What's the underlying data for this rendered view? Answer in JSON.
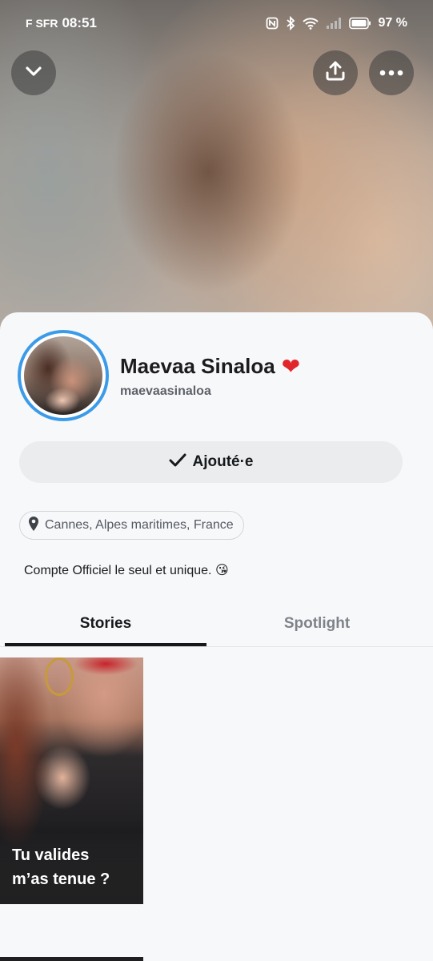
{
  "status_bar": {
    "carrier": "F SFR",
    "time": "08:51",
    "battery": "97 %"
  },
  "profile": {
    "display_name": "Maevaa Sinaloa",
    "name_emoji": "❤",
    "username": "maevaasinaloa",
    "add_button_label": "Ajouté·e",
    "location": "Cannes, Alpes maritimes, France",
    "bio": "Compte Officiel le seul et unique. 😘"
  },
  "tabs": [
    {
      "label": "Stories",
      "active": true
    },
    {
      "label": "Spotlight",
      "active": false
    }
  ],
  "stories": [
    {
      "caption_line1": "Tu valides",
      "caption_line2": "m’as tenue ?"
    }
  ],
  "colors": {
    "ring": "#3c9be8",
    "heart": "#e2252b",
    "active_tab": "#16191c",
    "inactive_tab": "#7f8389"
  },
  "icons": {
    "collapse": "chevron-down-icon",
    "share": "share-icon",
    "more": "more-dots-icon",
    "check": "check-icon",
    "location": "location-pin-icon"
  }
}
